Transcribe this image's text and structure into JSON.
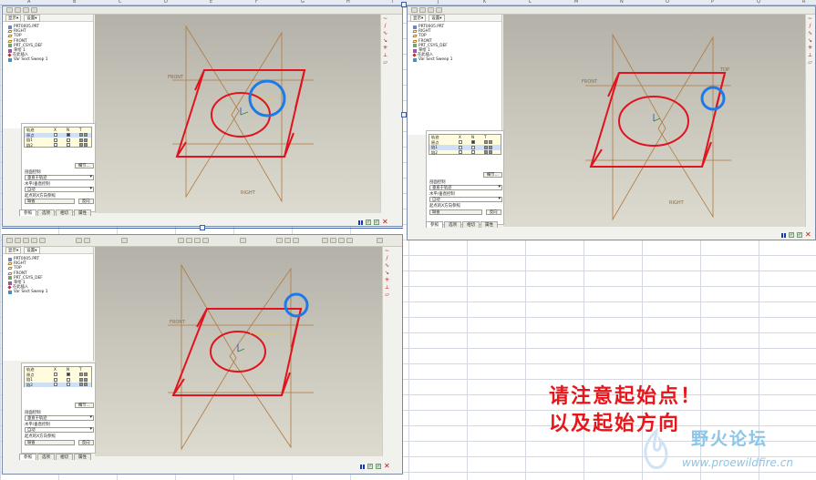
{
  "sheet": {
    "columns": [
      "A",
      "B",
      "C",
      "D",
      "E",
      "F",
      "G",
      "H",
      "I",
      "J",
      "K",
      "L",
      "M",
      "N",
      "O",
      "P",
      "Q",
      "R"
    ]
  },
  "panel": {
    "tree_header": [
      "显示▾",
      "设置▾"
    ],
    "model_tree": [
      {
        "label": "PRT0005.PRT",
        "icon": "doc"
      },
      {
        "label": "RIGHT",
        "icon": "plane"
      },
      {
        "label": "TOP",
        "icon": "plane"
      },
      {
        "label": "FRONT",
        "icon": "plane"
      },
      {
        "label": "PRT_CSYS_DEF",
        "icon": "csys"
      },
      {
        "label": "草绘 1",
        "icon": "sketch"
      },
      {
        "label": "在此插入",
        "icon": "insert"
      },
      {
        "label": "Var Sect Sweep 1",
        "icon": "sweep"
      }
    ],
    "trace_table": {
      "headers": [
        "轨迹",
        "X",
        "N",
        "T"
      ],
      "rows": [
        "原点",
        "链1",
        "链2"
      ]
    },
    "details_button": "细节...",
    "section_plane_control_label": "剖面控制",
    "section_plane_control_value": "垂直于轨迹",
    "horizontal_vertical_label": "水平/垂直控制",
    "horizontal_vertical_value": "自动",
    "start_x_direction_label": "起点的X方向参照",
    "start_x_direction_value": "缺省",
    "flip_button": "反向",
    "tabs": [
      "参照",
      "选项",
      "相切",
      "属性"
    ],
    "viewport_labels": {
      "front": "FRONT",
      "right": "RIGHT",
      "top": "TOP"
    }
  },
  "annotation": {
    "line1": "请注意起始点！",
    "line2": "以及起始方向"
  },
  "watermark": {
    "title": "野火论坛",
    "url": "www.proewildfire.cn"
  },
  "colors": {
    "sketch_red": "#e0141e",
    "highlight_blue": "#1e7ae8",
    "datum_brown": "#b07a40",
    "note_red": "#e8161a"
  }
}
